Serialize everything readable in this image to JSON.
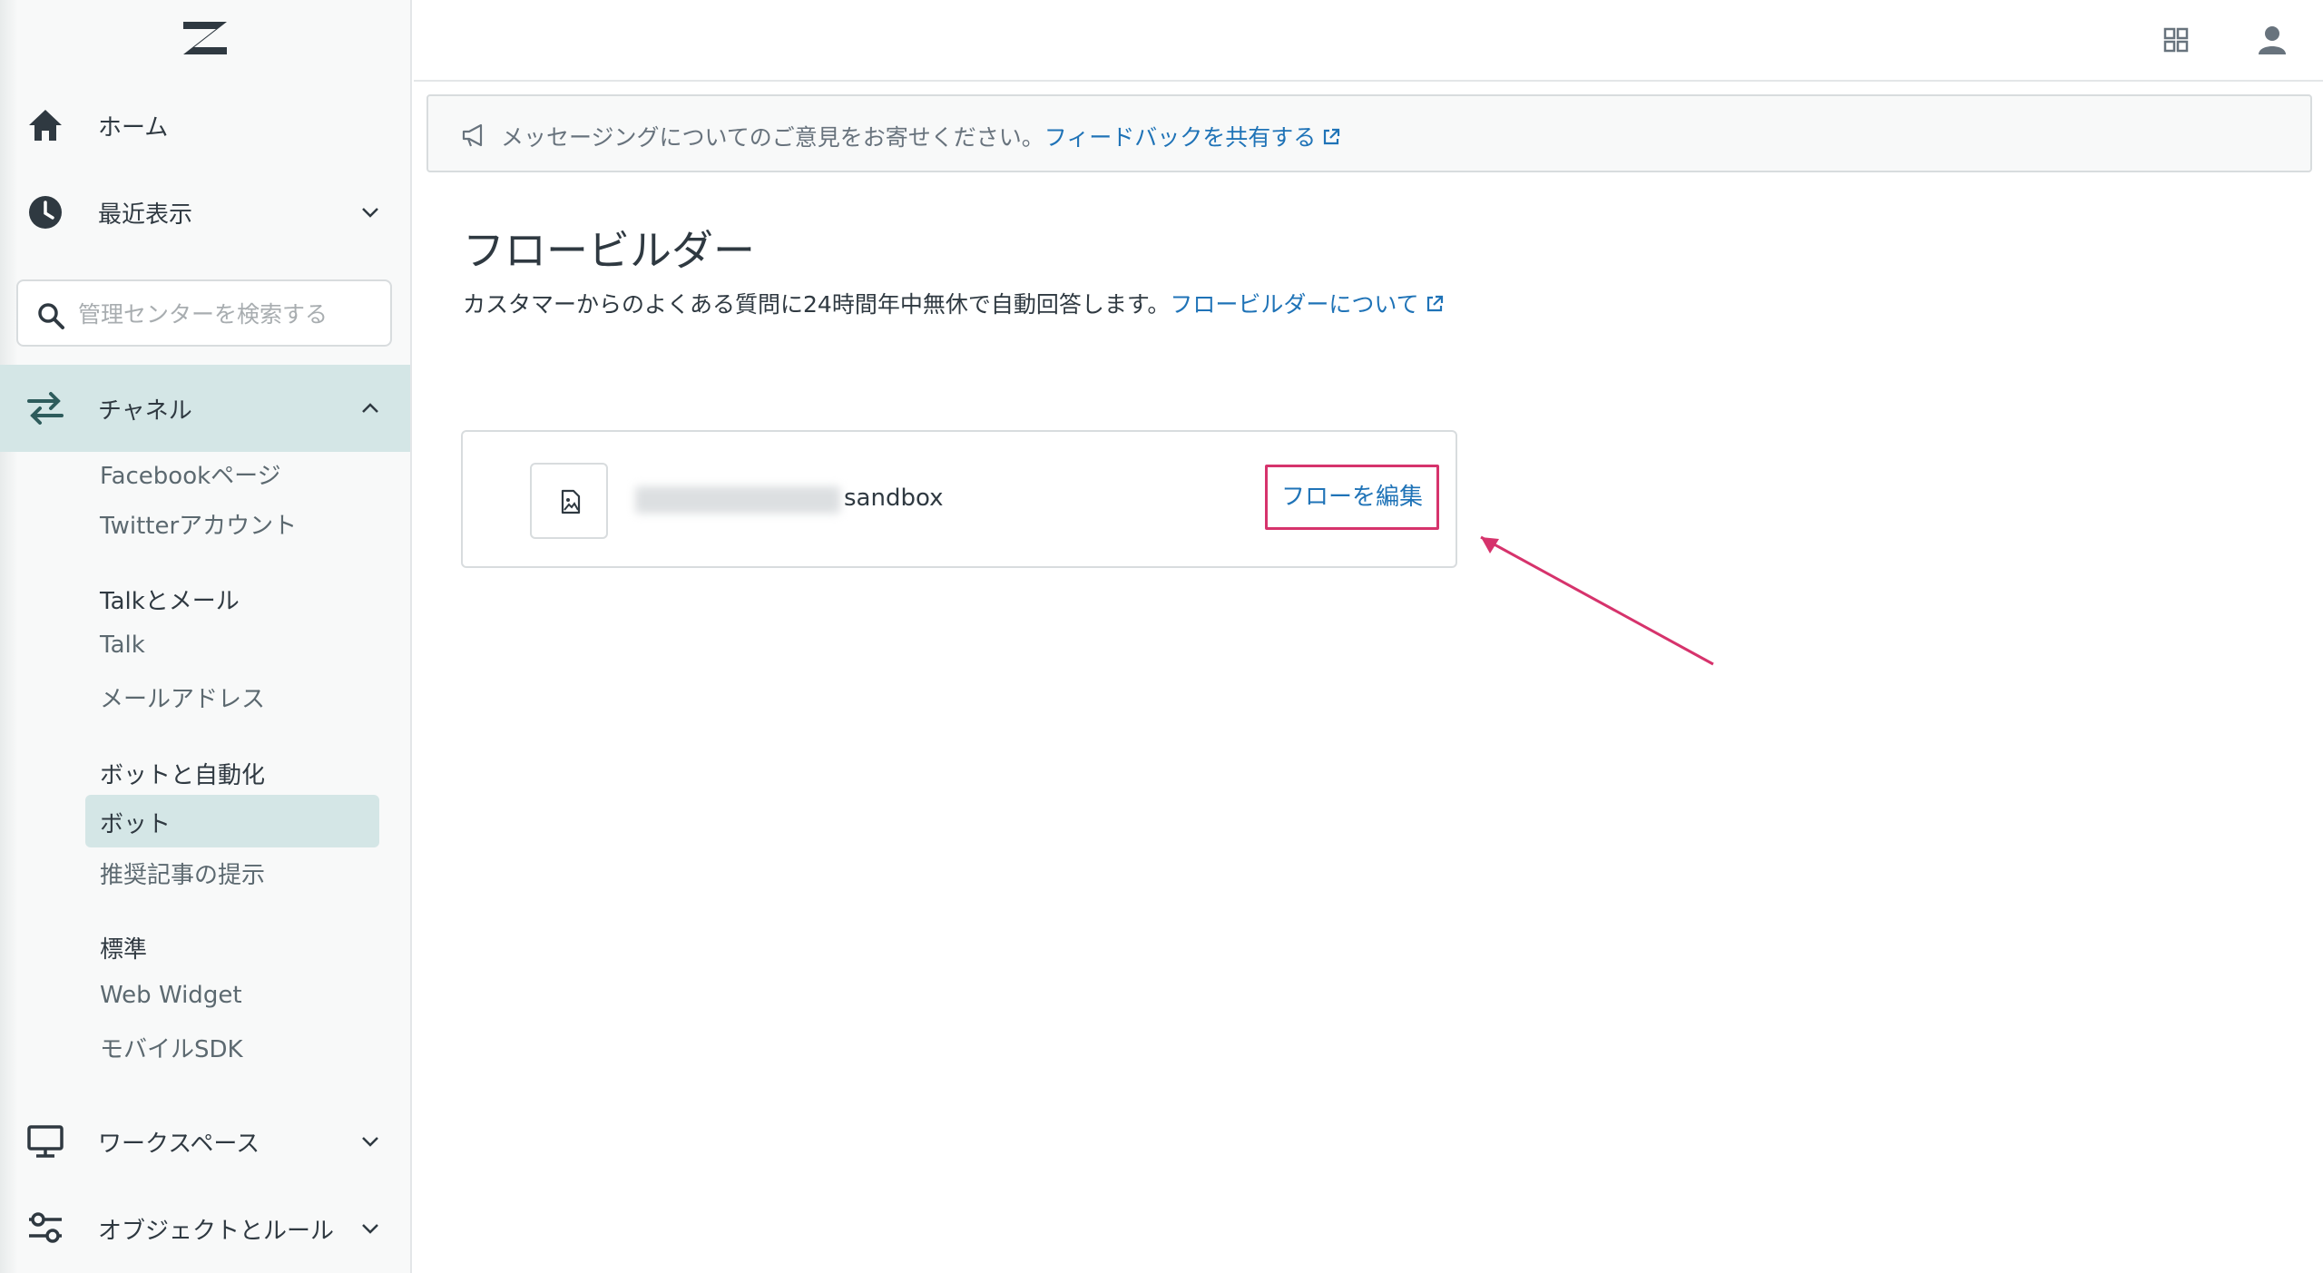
{
  "sidebar": {
    "nav": {
      "home": "ホーム",
      "recent": "最近表示",
      "channels": "チャネル",
      "workspaces": "ワークスペース",
      "objects": "オブジェクトとルール"
    },
    "search": {
      "placeholder": "管理センターを検索する",
      "value": ""
    },
    "channels_sub": {
      "facebook": "Facebookページ",
      "twitter": "Twitterアカウント",
      "talk_email_head": "Talkとメール",
      "talk": "Talk",
      "email": "メールアドレス",
      "bots_head": "ボットと自動化",
      "bots": "ボット",
      "article_rec": "推奨記事の提示",
      "standard_head": "標準",
      "web_widget": "Web Widget",
      "mobile_sdk": "モバイルSDK"
    }
  },
  "banner": {
    "text": "メッセージングについてのご意見をお寄せください。",
    "link": "フィードバックを共有する"
  },
  "main": {
    "title": "フロービルダー",
    "description": "カスタマーからのよくある質問に24時間年中無休で自動回答します。",
    "about_link": "フロービルダーについて"
  },
  "bot_card": {
    "name": "sandbox",
    "edit_label": "フローを編集"
  },
  "colors": {
    "accent": "#1f73b7",
    "highlight": "#d6336c",
    "active_bg": "#d4e6e6",
    "icon_teal": "#2e5c5c"
  },
  "icons": {
    "logo": "zendesk-logo",
    "home": "home-icon",
    "recent": "clock-icon",
    "channels": "transfer-arrows-icon",
    "workspaces": "monitor-icon",
    "objects": "sliders-icon",
    "apps": "grid-icon",
    "user": "user-icon"
  }
}
